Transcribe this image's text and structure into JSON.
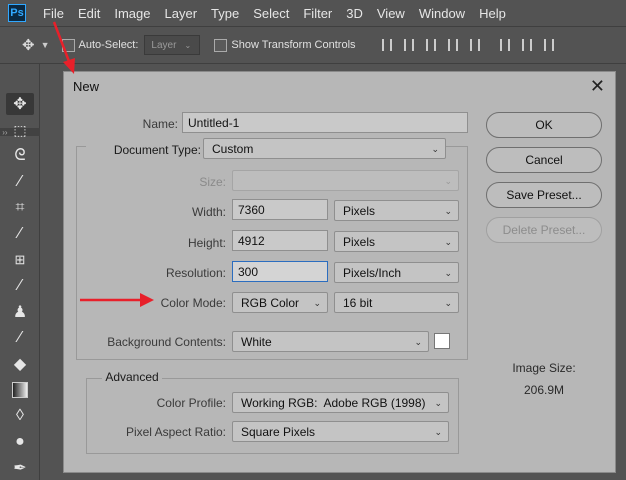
{
  "app": {
    "logo": "Ps"
  },
  "menu": [
    "File",
    "Edit",
    "Image",
    "Layer",
    "Type",
    "Select",
    "Filter",
    "3D",
    "View",
    "Window",
    "Help"
  ],
  "options_bar": {
    "auto_select_label": "Auto-Select:",
    "auto_select_value": "Layer",
    "show_transform_label": "Show Transform Controls"
  },
  "dialog": {
    "title": "New",
    "name_label": "Name:",
    "name_value": "Untitled-1",
    "doc_type_label": "Document Type:",
    "doc_type_value": "Custom",
    "size_label": "Size:",
    "size_value": "",
    "width_label": "Width:",
    "width_value": "7360",
    "width_unit": "Pixels",
    "height_label": "Height:",
    "height_value": "4912",
    "height_unit": "Pixels",
    "resolution_label": "Resolution:",
    "resolution_value": "300",
    "resolution_unit": "Pixels/Inch",
    "color_mode_label": "Color Mode:",
    "color_mode_value": "RGB Color",
    "bit_depth_value": "16 bit",
    "background_label": "Background Contents:",
    "background_value": "White",
    "advanced_label": "Advanced",
    "color_profile_label": "Color Profile:",
    "color_profile_value": "Working RGB:  Adobe RGB (1998)",
    "pixel_aspect_label": "Pixel Aspect Ratio:",
    "pixel_aspect_value": "Square Pixels",
    "buttons": {
      "ok": "OK",
      "cancel": "Cancel",
      "save_preset": "Save Preset...",
      "delete_preset": "Delete Preset..."
    },
    "image_size_label": "Image Size:",
    "image_size_value": "206.9M"
  },
  "colors": {
    "annotation_arrow": "#e8202a",
    "focus_border": "#2b6dbf"
  }
}
